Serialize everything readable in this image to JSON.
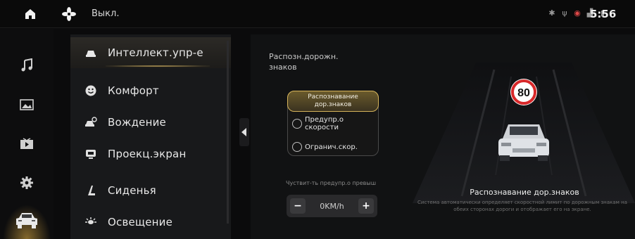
{
  "statusbar": {
    "fan_label": "Выкл.",
    "time": "5:56",
    "icons": [
      "bluetooth-icon",
      "usb-icon",
      "record-icon",
      "signal-icon",
      "battery-icon"
    ]
  },
  "rail": {
    "items": [
      "music-icon",
      "gallery-icon",
      "video-icon",
      "settings-icon",
      "car-icon"
    ],
    "active_index": 4
  },
  "menu": {
    "items": [
      {
        "label": "Интеллект.упр-е",
        "icon": "seat-steer-icon",
        "active": true
      },
      {
        "label": "Комфорт",
        "icon": "smile-icon",
        "active": false
      },
      {
        "label": "Вождение",
        "icon": "car-steer-icon",
        "active": false
      },
      {
        "label": "Проекц.экран",
        "icon": "screen-icon",
        "active": false
      },
      {
        "label": "Сиденья",
        "icon": "seat-icon",
        "active": false
      },
      {
        "label": "Освещение",
        "icon": "light-icon",
        "active": false
      }
    ]
  },
  "panel": {
    "title_line1": "Распозн.дорожн.",
    "title_line2": "знаков",
    "option_header_line1": "Распознавание",
    "option_header_line2": "дор.знаков",
    "option1_line1": "Предупр.о",
    "option1_line2": "скорости",
    "option2": "Огранич.скор.",
    "sensitivity_label": "Чуствит-ть предупр.о превыш",
    "stepper_minus": "−",
    "stepper_value": "0KM/h",
    "stepper_plus": "+",
    "sign_value": "80",
    "desc_title": "Распознавание дор.знаков",
    "desc_text": "Система автоматически определяет скоростной лимит по дорожным знакам на обеих сторонах дороги и отображает его на экране."
  },
  "colors": {
    "accent_gold": "#d6b45a",
    "sign_red": "#d8282a"
  }
}
